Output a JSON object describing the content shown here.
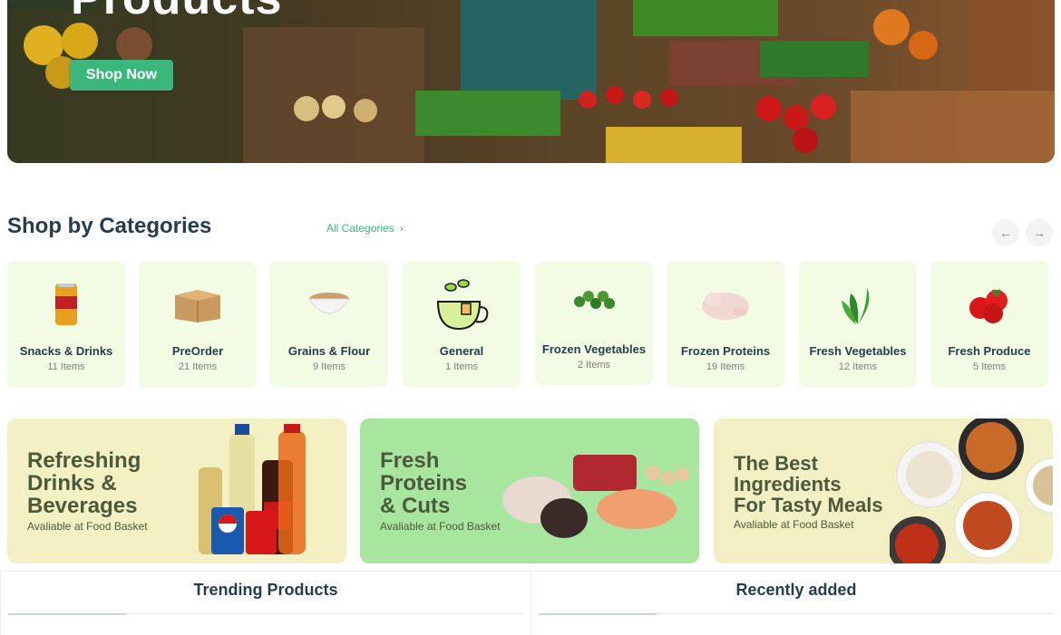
{
  "hero": {
    "title": "Products",
    "cta_label": "Shop Now"
  },
  "categories_section": {
    "title": "Shop by Categories",
    "all_link": "All Categories",
    "prev_icon": "arrow-left-icon",
    "next_icon": "arrow-right-icon",
    "items": [
      {
        "name": "Snacks & Drinks",
        "count": "11 Items"
      },
      {
        "name": "PreOrder",
        "count": "21 Items"
      },
      {
        "name": "Grains & Flour",
        "count": "9 Items"
      },
      {
        "name": "General",
        "count": "1 Items"
      },
      {
        "name": "Frozen Vegetables",
        "count": "2 Items"
      },
      {
        "name": "Frozen Proteins",
        "count": "19 Items"
      },
      {
        "name": "Fresh Vegetables",
        "count": "12 Items"
      },
      {
        "name": "Fresh Produce",
        "count": "5 Items"
      }
    ]
  },
  "promos": [
    {
      "line1": "Refreshing",
      "line2": "Drinks &",
      "line3": "Beverages",
      "subtitle": "Avaliable at Food Basket"
    },
    {
      "line1": "Fresh",
      "line2": "Proteins",
      "line3": "& Cuts",
      "subtitle": "Avaliable at Food Basket"
    },
    {
      "line1": "The Best",
      "line2": "Ingredients",
      "line3": "For Tasty Meals",
      "subtitle": "Avaliable at Food Basket"
    }
  ],
  "tabs": {
    "trending": "Trending Products",
    "recent": "Recently added"
  },
  "colors": {
    "brand_green": "#3bb77e",
    "heading": "#253d4e",
    "card_bg": "#f2fce4"
  }
}
